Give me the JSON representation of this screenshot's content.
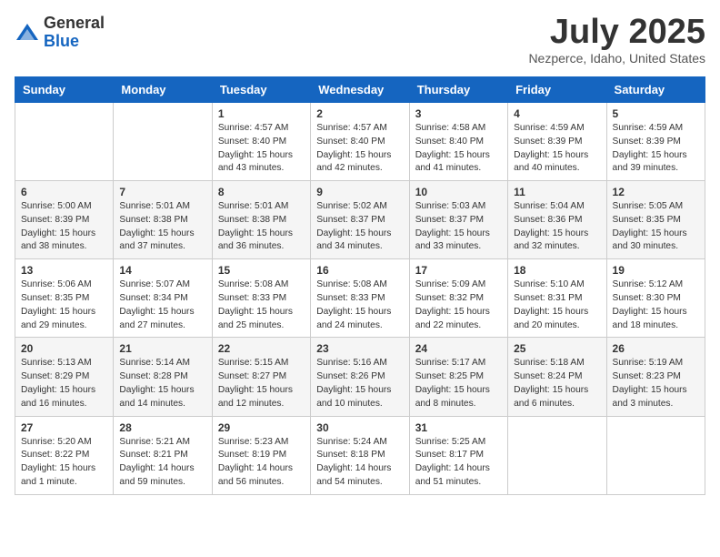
{
  "header": {
    "logo_general": "General",
    "logo_blue": "Blue",
    "month": "July 2025",
    "location": "Nezperce, Idaho, United States"
  },
  "days_of_week": [
    "Sunday",
    "Monday",
    "Tuesday",
    "Wednesday",
    "Thursday",
    "Friday",
    "Saturday"
  ],
  "weeks": [
    [
      {
        "day": "",
        "info": ""
      },
      {
        "day": "",
        "info": ""
      },
      {
        "day": "1",
        "info": "Sunrise: 4:57 AM\nSunset: 8:40 PM\nDaylight: 15 hours and 43 minutes."
      },
      {
        "day": "2",
        "info": "Sunrise: 4:57 AM\nSunset: 8:40 PM\nDaylight: 15 hours and 42 minutes."
      },
      {
        "day": "3",
        "info": "Sunrise: 4:58 AM\nSunset: 8:40 PM\nDaylight: 15 hours and 41 minutes."
      },
      {
        "day": "4",
        "info": "Sunrise: 4:59 AM\nSunset: 8:39 PM\nDaylight: 15 hours and 40 minutes."
      },
      {
        "day": "5",
        "info": "Sunrise: 4:59 AM\nSunset: 8:39 PM\nDaylight: 15 hours and 39 minutes."
      }
    ],
    [
      {
        "day": "6",
        "info": "Sunrise: 5:00 AM\nSunset: 8:39 PM\nDaylight: 15 hours and 38 minutes."
      },
      {
        "day": "7",
        "info": "Sunrise: 5:01 AM\nSunset: 8:38 PM\nDaylight: 15 hours and 37 minutes."
      },
      {
        "day": "8",
        "info": "Sunrise: 5:01 AM\nSunset: 8:38 PM\nDaylight: 15 hours and 36 minutes."
      },
      {
        "day": "9",
        "info": "Sunrise: 5:02 AM\nSunset: 8:37 PM\nDaylight: 15 hours and 34 minutes."
      },
      {
        "day": "10",
        "info": "Sunrise: 5:03 AM\nSunset: 8:37 PM\nDaylight: 15 hours and 33 minutes."
      },
      {
        "day": "11",
        "info": "Sunrise: 5:04 AM\nSunset: 8:36 PM\nDaylight: 15 hours and 32 minutes."
      },
      {
        "day": "12",
        "info": "Sunrise: 5:05 AM\nSunset: 8:35 PM\nDaylight: 15 hours and 30 minutes."
      }
    ],
    [
      {
        "day": "13",
        "info": "Sunrise: 5:06 AM\nSunset: 8:35 PM\nDaylight: 15 hours and 29 minutes."
      },
      {
        "day": "14",
        "info": "Sunrise: 5:07 AM\nSunset: 8:34 PM\nDaylight: 15 hours and 27 minutes."
      },
      {
        "day": "15",
        "info": "Sunrise: 5:08 AM\nSunset: 8:33 PM\nDaylight: 15 hours and 25 minutes."
      },
      {
        "day": "16",
        "info": "Sunrise: 5:08 AM\nSunset: 8:33 PM\nDaylight: 15 hours and 24 minutes."
      },
      {
        "day": "17",
        "info": "Sunrise: 5:09 AM\nSunset: 8:32 PM\nDaylight: 15 hours and 22 minutes."
      },
      {
        "day": "18",
        "info": "Sunrise: 5:10 AM\nSunset: 8:31 PM\nDaylight: 15 hours and 20 minutes."
      },
      {
        "day": "19",
        "info": "Sunrise: 5:12 AM\nSunset: 8:30 PM\nDaylight: 15 hours and 18 minutes."
      }
    ],
    [
      {
        "day": "20",
        "info": "Sunrise: 5:13 AM\nSunset: 8:29 PM\nDaylight: 15 hours and 16 minutes."
      },
      {
        "day": "21",
        "info": "Sunrise: 5:14 AM\nSunset: 8:28 PM\nDaylight: 15 hours and 14 minutes."
      },
      {
        "day": "22",
        "info": "Sunrise: 5:15 AM\nSunset: 8:27 PM\nDaylight: 15 hours and 12 minutes."
      },
      {
        "day": "23",
        "info": "Sunrise: 5:16 AM\nSunset: 8:26 PM\nDaylight: 15 hours and 10 minutes."
      },
      {
        "day": "24",
        "info": "Sunrise: 5:17 AM\nSunset: 8:25 PM\nDaylight: 15 hours and 8 minutes."
      },
      {
        "day": "25",
        "info": "Sunrise: 5:18 AM\nSunset: 8:24 PM\nDaylight: 15 hours and 6 minutes."
      },
      {
        "day": "26",
        "info": "Sunrise: 5:19 AM\nSunset: 8:23 PM\nDaylight: 15 hours and 3 minutes."
      }
    ],
    [
      {
        "day": "27",
        "info": "Sunrise: 5:20 AM\nSunset: 8:22 PM\nDaylight: 15 hours and 1 minute."
      },
      {
        "day": "28",
        "info": "Sunrise: 5:21 AM\nSunset: 8:21 PM\nDaylight: 14 hours and 59 minutes."
      },
      {
        "day": "29",
        "info": "Sunrise: 5:23 AM\nSunset: 8:19 PM\nDaylight: 14 hours and 56 minutes."
      },
      {
        "day": "30",
        "info": "Sunrise: 5:24 AM\nSunset: 8:18 PM\nDaylight: 14 hours and 54 minutes."
      },
      {
        "day": "31",
        "info": "Sunrise: 5:25 AM\nSunset: 8:17 PM\nDaylight: 14 hours and 51 minutes."
      },
      {
        "day": "",
        "info": ""
      },
      {
        "day": "",
        "info": ""
      }
    ]
  ]
}
